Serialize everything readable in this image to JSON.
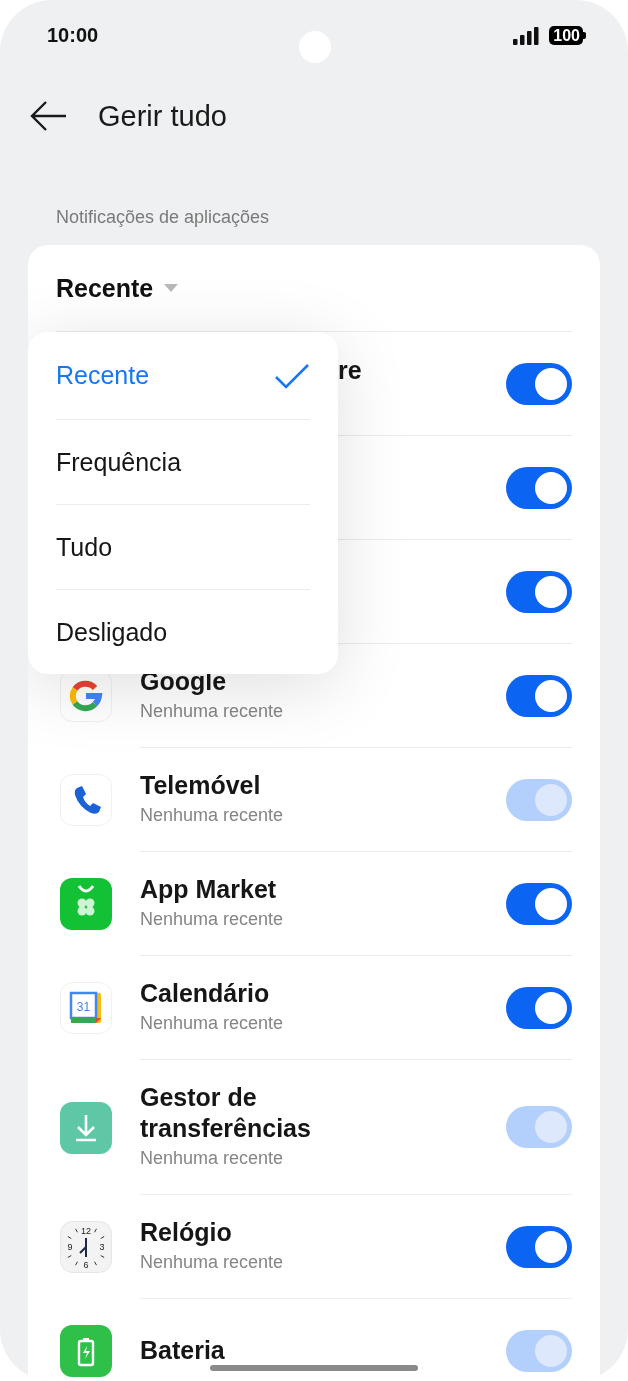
{
  "status_bar": {
    "time": "10:00",
    "battery": "100"
  },
  "header": {
    "title": "Gerir tudo"
  },
  "section_label": "Notificações de aplicações",
  "sort": {
    "label": "Recente"
  },
  "sort_menu": [
    {
      "label": "Recente",
      "selected": true
    },
    {
      "label": "Frequência",
      "selected": false
    },
    {
      "label": "Tudo",
      "selected": false
    },
    {
      "label": "Desligado",
      "selected": false
    }
  ],
  "rows": [
    {
      "kind": "covered",
      "name": "re",
      "on": true,
      "disabled": false
    },
    {
      "kind": "covered",
      "on": true,
      "disabled": false
    },
    {
      "kind": "covered",
      "on": true,
      "disabled": false
    },
    {
      "kind": "google",
      "name": "Google",
      "subtitle": "Nenhuma recente",
      "on": true,
      "disabled": false
    },
    {
      "kind": "phone",
      "name": "Telemóvel",
      "subtitle": "Nenhuma recente",
      "on": true,
      "disabled": true
    },
    {
      "kind": "market",
      "name": "App Market",
      "subtitle": "Nenhuma recente",
      "on": true,
      "disabled": false
    },
    {
      "kind": "calendar",
      "name": "Calendário",
      "subtitle": "Nenhuma recente",
      "icon_text": "31",
      "on": true,
      "disabled": false
    },
    {
      "kind": "download",
      "name": "Gestor de transferências",
      "subtitle": "Nenhuma recente",
      "on": true,
      "disabled": true
    },
    {
      "kind": "clock",
      "name": "Relógio",
      "subtitle": "Nenhuma recente",
      "dial": [
        "12",
        "3",
        "6",
        "9"
      ],
      "on": true,
      "disabled": false
    },
    {
      "kind": "battery",
      "name": "Bateria",
      "on": true,
      "disabled": true
    }
  ]
}
